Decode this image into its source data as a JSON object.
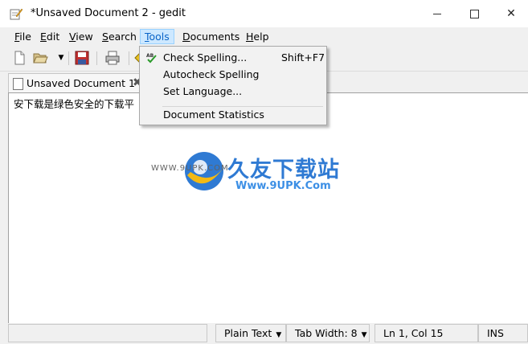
{
  "window": {
    "title": "*Unsaved Document 2 - gedit"
  },
  "menubar": {
    "items": [
      {
        "label": "File",
        "ul": "F",
        "rest": "ile"
      },
      {
        "label": "Edit",
        "ul": "E",
        "rest": "dit"
      },
      {
        "label": "View",
        "ul": "V",
        "rest": "iew"
      },
      {
        "label": "Search",
        "ul": "S",
        "rest": "earch"
      },
      {
        "label": "Tools",
        "ul": "T",
        "rest": "ools"
      },
      {
        "label": "Documents",
        "ul": "D",
        "rest": "ocuments"
      },
      {
        "label": "Help",
        "ul": "H",
        "rest": "elp"
      }
    ]
  },
  "tools_menu": {
    "items": [
      {
        "label": "Check Spelling...",
        "shortcut": "Shift+F7",
        "icon": "spellcheck-icon"
      },
      {
        "label": "Autocheck Spelling",
        "shortcut": ""
      },
      {
        "label": "Set Language...",
        "shortcut": ""
      },
      {
        "label": "Document Statistics",
        "shortcut": ""
      }
    ]
  },
  "tab": {
    "label": "Unsaved Document 1"
  },
  "editor": {
    "content": "安下载是绿色安全的下载平"
  },
  "watermark": {
    "brand": "久友下载站",
    "url": "Www.9UPK.Com",
    "small": "WWW.9UPK.COM"
  },
  "statusbar": {
    "language": "Plain Text",
    "tab_width": "Tab Width: 8",
    "position": "Ln 1, Col 15",
    "mode": "INS"
  },
  "colors": {
    "menu_active": "#cde8ff",
    "accent": "#1e6fd0"
  }
}
